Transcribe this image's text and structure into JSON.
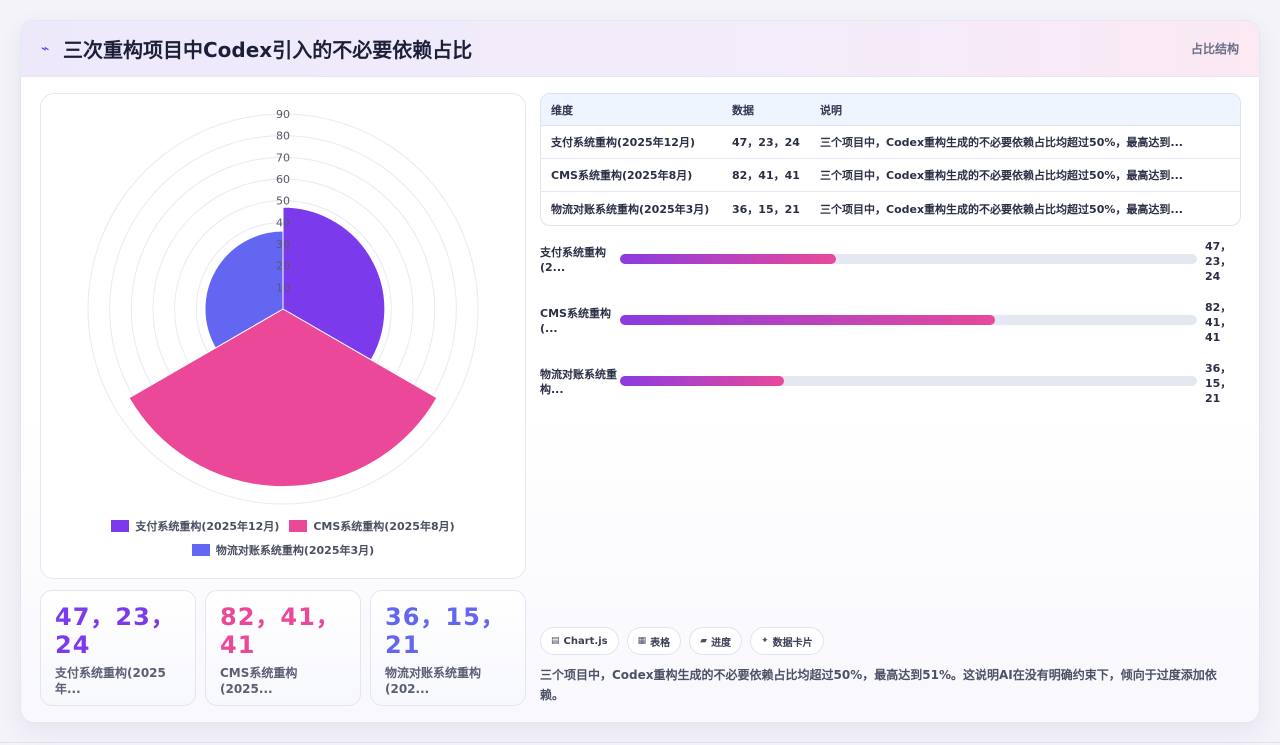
{
  "header": {
    "icon": "flash-icon",
    "title": "三次重构项目中Codex引入的不必要依赖占比",
    "tag": "占比结构"
  },
  "chart_data": {
    "type": "polar-area",
    "series_labels": [
      "支付系统重构(2025年12月)",
      "CMS系统重构(2025年8月)",
      "物流对账系统重构(2025年3月)"
    ],
    "values": [
      47,
      82,
      36
    ],
    "colors": [
      "#7c3aed",
      "#ec4899",
      "#6366f1"
    ],
    "r_ticks": [
      "10",
      "20",
      "30",
      "40",
      "50",
      "60",
      "70",
      "80",
      "90"
    ],
    "r_max": 90
  },
  "stats": [
    {
      "value": "47，23，24",
      "label": "支付系统重构(2025年...",
      "color": "#7c3aed"
    },
    {
      "value": "82，41，41",
      "label": "CMS系统重构(2025...",
      "color": "#ec4899"
    },
    {
      "value": "36，15，21",
      "label": "物流对账系统重构(202...",
      "color": "#6366f1"
    }
  ],
  "table": {
    "headers": [
      "维度",
      "数据",
      "说明"
    ],
    "rows": [
      {
        "dim": "支付系统重构(2025年12月)",
        "data": "47，23，24",
        "note": "三个项目中，Codex重构生成的不必要依赖占比均超过50%，最高达到..."
      },
      {
        "dim": "CMS系统重构(2025年8月)",
        "data": "82，41，41",
        "note": "三个项目中，Codex重构生成的不必要依赖占比均超过50%，最高达到..."
      },
      {
        "dim": "物流对账系统重构(2025年3月)",
        "data": "36，15，21",
        "note": "三个项目中，Codex重构生成的不必要依赖占比均超过50%，最高达到..."
      }
    ]
  },
  "bars": [
    {
      "label": "支付系统重构(2...",
      "value": "47，23，24",
      "fraction": 0.375
    },
    {
      "label": "CMS系统重构(...",
      "value": "82，41，41",
      "fraction": 0.65
    },
    {
      "label": "物流对账系统重构...",
      "value": "36，15，21",
      "fraction": 0.285
    }
  ],
  "chips": [
    {
      "icon": "chart-icon",
      "label": "Chart.js"
    },
    {
      "icon": "table-icon",
      "label": "表格"
    },
    {
      "icon": "progress-icon",
      "label": "进度"
    },
    {
      "icon": "sparkle-icon",
      "label": "数据卡片"
    }
  ],
  "summary": "三个项目中，Codex重构生成的不必要依赖占比均超过50%，最高达到51%。这说明AI在没有明确约束下，倾向于过度添加依赖。"
}
